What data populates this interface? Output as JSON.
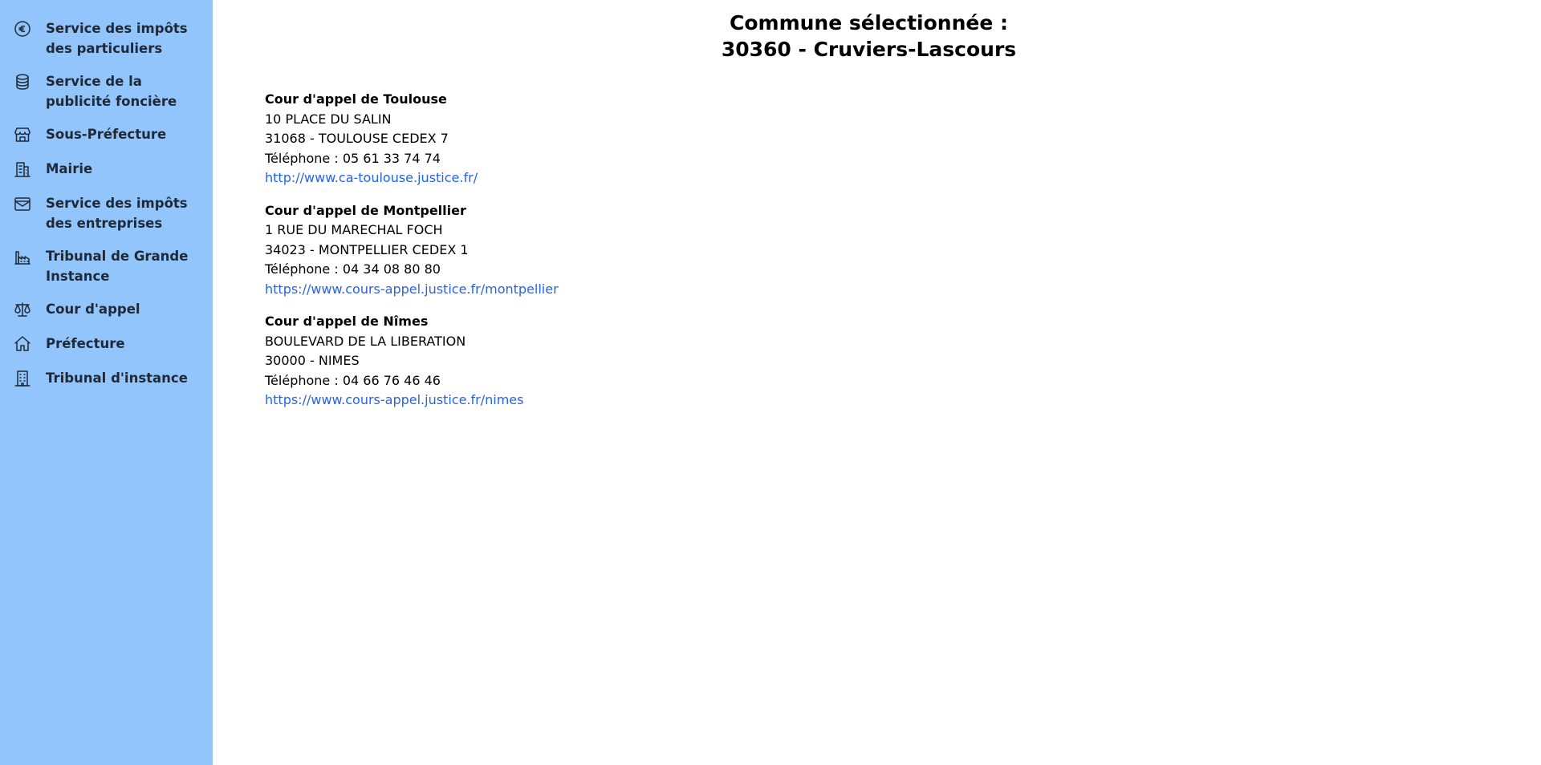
{
  "sidebar": {
    "items": [
      {
        "label": "Service des impôts des particuliers",
        "icon": "euro-icon"
      },
      {
        "label": "Service de la publicité foncière",
        "icon": "database-icon"
      },
      {
        "label": "Sous-Préfecture",
        "icon": "storefront-icon"
      },
      {
        "label": "Mairie",
        "icon": "office-building-icon"
      },
      {
        "label": "Service des impôts des entreprises",
        "icon": "archive-box-icon"
      },
      {
        "label": "Tribunal de Grande Instance",
        "icon": "factory-icon"
      },
      {
        "label": "Cour d'appel",
        "icon": "scale-icon"
      },
      {
        "label": "Préfecture",
        "icon": "home-icon"
      },
      {
        "label": "Tribunal d'instance",
        "icon": "building-icon"
      }
    ]
  },
  "main": {
    "title_line1": "Commune sélectionnée :",
    "title_line2": "30360 - Cruviers-Lascours",
    "courts": [
      {
        "name": "Cour d'appel de Toulouse",
        "address": "10 PLACE DU SALIN",
        "city": "31068 - TOULOUSE CEDEX 7",
        "phone": "Téléphone : 05 61 33 74 74",
        "url": "http://www.ca-toulouse.justice.fr/"
      },
      {
        "name": "Cour d'appel de Montpellier",
        "address": "1 RUE DU MARECHAL FOCH",
        "city": "34023 - MONTPELLIER CEDEX 1",
        "phone": "Téléphone : 04 34 08 80 80",
        "url": "https://www.cours-appel.justice.fr/montpellier"
      },
      {
        "name": "Cour d'appel de Nîmes",
        "address": "BOULEVARD DE LA LIBERATION",
        "city": "30000 - NIMES",
        "phone": "Téléphone : 04 66 76 46 46",
        "url": "https://www.cours-appel.justice.fr/nimes"
      }
    ]
  },
  "colors": {
    "sidebar_bg": "#93c5fd",
    "link": "#2563eb",
    "text": "#000000"
  }
}
